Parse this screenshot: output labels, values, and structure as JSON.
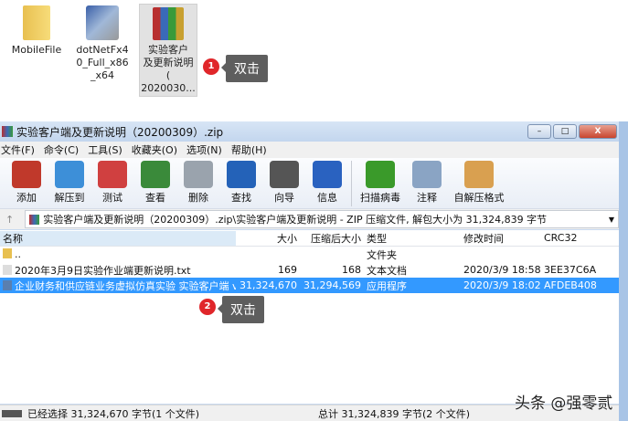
{
  "desktop": {
    "icons": [
      {
        "label": "MobileFile"
      },
      {
        "label": "dotNetFx40_Full_x86_x64"
      },
      {
        "label": "实验客户端及更新说明（20200309...",
        "lines": [
          "实验客户",
          "及更新说明",
          "(",
          "2020030..."
        ]
      }
    ],
    "dn_lines": [
      "dotNetFx4",
      "0_Full_x86",
      "_x64"
    ],
    "step1": {
      "num": "1",
      "text": "双击"
    }
  },
  "window": {
    "title": "实验客户端及更新说明（20200309）.zip",
    "menu": [
      "文件(F)",
      "命令(C)",
      "工具(S)",
      "收藏夹(O)",
      "选项(N)",
      "帮助(H)"
    ],
    "toolbar": [
      {
        "label": "添加",
        "icon": "add-icon",
        "color": "#c0392b"
      },
      {
        "label": "解压到",
        "icon": "extract-folder-icon",
        "color": "#3d8fd8"
      },
      {
        "label": "测试",
        "icon": "test-clipboard-icon",
        "color": "#d04040"
      },
      {
        "label": "查看",
        "icon": "view-book-icon",
        "color": "#3a8a3a"
      },
      {
        "label": "删除",
        "icon": "trash-icon",
        "color": "#9aa3ad"
      },
      {
        "label": "查找",
        "icon": "search-icon",
        "color": "#2462b8"
      },
      {
        "label": "向导",
        "icon": "wizard-wand-icon",
        "color": "#555"
      },
      {
        "label": "信息",
        "icon": "info-icon",
        "color": "#2a62c0"
      },
      {
        "label": "扫描病毒",
        "icon": "virus-scan-icon",
        "color": "#3a9a2a"
      },
      {
        "label": "注释",
        "icon": "comment-icon",
        "color": "#8aa4c4"
      },
      {
        "label": "自解压格式",
        "icon": "sfx-box-icon",
        "color": "#d9a050"
      }
    ],
    "address": "实验客户端及更新说明（20200309）.zip\\实验客户端及更新说明 - ZIP 压缩文件, 解包大小为 31,324,839 字节",
    "columns": [
      "名称",
      "大小",
      "压缩后大小",
      "类型",
      "修改时间",
      "CRC32"
    ],
    "rows": [
      {
        "name": "..",
        "size": "",
        "packed": "",
        "type": "文件夹",
        "modified": "",
        "crc": ""
      },
      {
        "name": "2020年3月9日实验作业端更新说明.txt",
        "size": "169",
        "packed": "168",
        "type": "文本文档",
        "modified": "2020/3/9 18:58",
        "crc": "3EE37C6A"
      },
      {
        "name": "企业财务和供应链业务虚拟仿真实验 实验客户端 v...",
        "size": "31,324,670",
        "packed": "31,294,569",
        "type": "应用程序",
        "modified": "2020/3/9 18:02",
        "crc": "AFDEB408"
      }
    ],
    "step2": {
      "num": "2",
      "text": "双击"
    },
    "status_left": "已经选择 31,324,670 字节(1 个文件)",
    "status_right": "总计 31,324,839 字节(2 个文件)"
  },
  "watermark": "头条 @强零贰"
}
